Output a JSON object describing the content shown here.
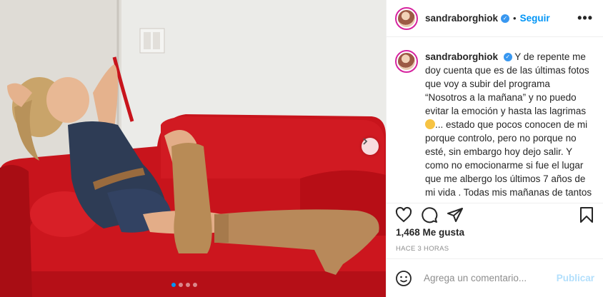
{
  "post": {
    "username": "sandraborghiok",
    "follow_label": "Seguir",
    "separator": "•",
    "more_label": "•••",
    "caption": {
      "username": "sandraborghiok",
      "text_1": "Y de repente me doy cuenta que es de las últimas fotos que voy a subir del programa “Nosotros a la mañana” y no puedo evitar la emoción y hasta las lagrimas",
      "text_2": "... estado que pocos conocen de mi porque controlo, pero no porque no esté, sin embargo hoy dejo salir. Y como no emocionarme si fue el lugar que me albergo los últimos 7 años de mi vida . Todas mis mañanas de tantos años te crecimos y vivimos LAS"
    },
    "likes": "1,468 Me gusta",
    "time_ago": "HACE 3 HORAS",
    "comment_placeholder": "Agrega un comentario...",
    "publish_label": "Publicar",
    "carousel": {
      "count": 4,
      "active": 0
    }
  },
  "icons": [
    "verified-badge-icon",
    "heart-icon",
    "comment-icon",
    "share-icon",
    "bookmark-icon",
    "emoji-icon",
    "chevron-right-icon"
  ],
  "colors": {
    "accent": "#0095f6",
    "verified": "#3897f0",
    "sofa": "#c8141c",
    "publish_disabled": "#b2dffc"
  }
}
